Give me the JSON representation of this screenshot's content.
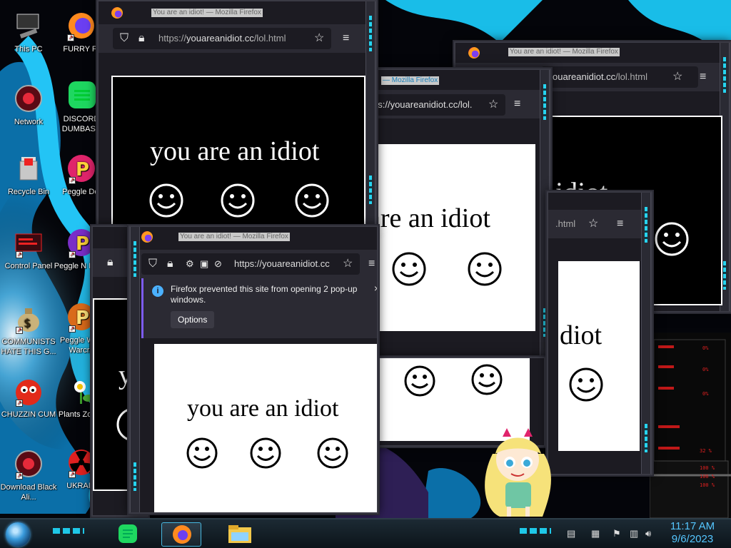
{
  "desktop_icons": [
    {
      "label": "This PC",
      "icon": "computer-icon"
    },
    {
      "label": "FURRY F",
      "icon": "firefox-icon"
    },
    {
      "label": "Network",
      "icon": "network-icon"
    },
    {
      "label": "DISCORD DUMBASS",
      "icon": "discord-icon"
    },
    {
      "label": "Recycle Bin",
      "icon": "recycle-bin-icon"
    },
    {
      "label": "Peggle Del",
      "icon": "peggle-icon"
    },
    {
      "label": "Control Panel",
      "icon": "control-panel-icon"
    },
    {
      "label": "Peggle N Delux",
      "icon": "peggle-icon"
    },
    {
      "label": "COMMUNISTS HATE THIS G...",
      "icon": "money-bag-icon"
    },
    {
      "label": "Peggle W of Warcra",
      "icon": "peggle-icon"
    },
    {
      "label": "CHUZZIN CUM",
      "icon": "chuzzle-icon"
    },
    {
      "label": "Plants Zombi",
      "icon": "plants-zombies-icon"
    },
    {
      "label": "Download Black Ali...",
      "icon": "download-icon"
    },
    {
      "label": "UKRAIN",
      "icon": "radiation-icon"
    }
  ],
  "window": {
    "title": "You are an idiot! — Mozilla Firefox",
    "url_scheme": "https://",
    "url_host": "youareanidiot.cc",
    "url_path": "/lol.html",
    "url_partial_1": "os://youareanidiot.cc/lol.",
    "url_partial_2": "ouareanidiot.cc",
    "url_partial_2_path": "/lol.html",
    "url_partial_3": "https://youareanidiot.cc",
    "url_partial_4": ".html",
    "title_partial": "— Mozilla Firefox",
    "page_text": "you are an idiot",
    "page_text_partial_a": "are an idiot",
    "page_text_partial_b": "idiot",
    "page_text_partial_c": "diot",
    "page_text_partial_d": "y"
  },
  "notification": {
    "message": "Firefox prevented this site from opening 2 pop-up windows.",
    "options_label": "Options",
    "close_label": "×"
  },
  "hud": {
    "readouts": [
      "0%",
      "0%",
      "0%",
      "32 %",
      "100 %",
      "100 %",
      "100 %"
    ]
  },
  "taskbar": {
    "pins": [
      "spotify-icon",
      "firefox-icon",
      "file-explorer-icon"
    ],
    "time": "11:17 AM",
    "date": "9/6/2023"
  },
  "colors": {
    "accent_cyan": "#26d4f0",
    "window_bg": "#1c1b22",
    "toolbar_bg": "#2b2a33",
    "clock_blue": "#55c6ff"
  }
}
